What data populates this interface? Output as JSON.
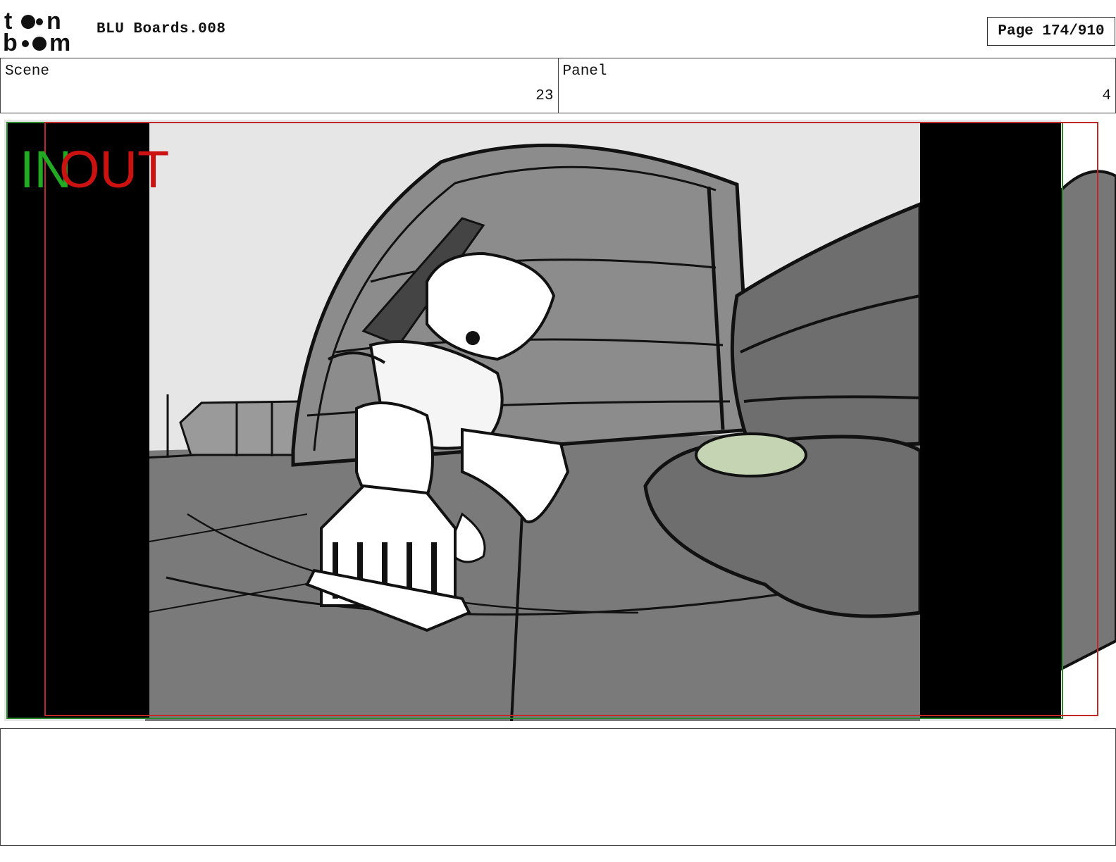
{
  "header": {
    "logo_line1": "toon",
    "logo_line2": "boom",
    "title": "BLU Boards.008",
    "page": "Page 174/910"
  },
  "scene": {
    "label": "Scene",
    "value": "23"
  },
  "panel": {
    "label": "Panel",
    "value": "4"
  },
  "frame_markers": {
    "in": "IN",
    "out": "OUT"
  },
  "colors": {
    "in_marker": "#22aa22",
    "out_marker": "#cc1111",
    "frame_red": "#c0282a",
    "letterbox": "#000000"
  },
  "icons": {
    "logo": "toon-boom-logo"
  },
  "notes": ""
}
